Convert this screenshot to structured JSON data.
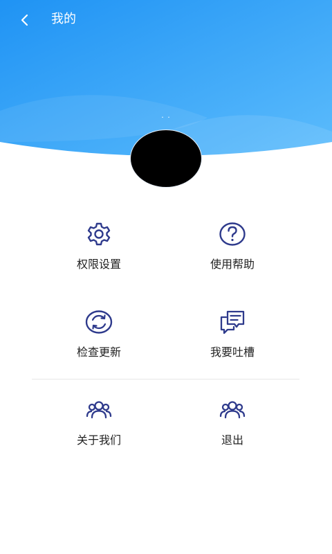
{
  "header": {
    "title": "我的",
    "username": ". .",
    "colors": {
      "gradient_start": "#2a9bf5",
      "gradient_end": "#4fb3fb"
    }
  },
  "menu": {
    "icon_color": "#2e3a8c",
    "items": [
      {
        "label": "权限设置",
        "icon": "gear-icon"
      },
      {
        "label": "使用帮助",
        "icon": "help-circle-icon"
      },
      {
        "label": "检查更新",
        "icon": "refresh-icon"
      },
      {
        "label": "我要吐槽",
        "icon": "chat-bubbles-icon"
      },
      {
        "label": "关于我们",
        "icon": "users-icon"
      },
      {
        "label": "退出",
        "icon": "users-icon"
      }
    ]
  }
}
